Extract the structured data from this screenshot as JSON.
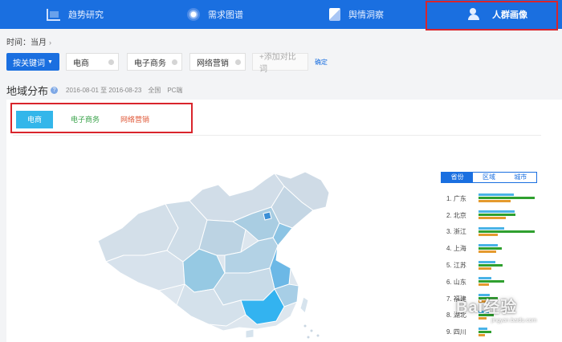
{
  "nav": {
    "items": [
      {
        "label": "趋势研究",
        "icon": "trend-chart-icon"
      },
      {
        "label": "需求图谱",
        "icon": "demand-graph-icon"
      },
      {
        "label": "舆情洞察",
        "icon": "opinion-icon"
      },
      {
        "label": "人群画像",
        "icon": "user-profile-icon"
      }
    ],
    "active_index": 3
  },
  "time": {
    "label": "时间：当月"
  },
  "keywords": {
    "type_button": "按关键词",
    "chips": [
      "电商",
      "电子商务",
      "网络营销"
    ],
    "add_label": "+添加对比词",
    "confirm_label": "确定"
  },
  "region": {
    "title": "地域分布",
    "date_range": "2016-08-01 至 2016-08-23",
    "scope": "全国",
    "platform": "PC端"
  },
  "compare_tabs": [
    {
      "label": "电商",
      "color": "#33b6ea"
    },
    {
      "label": "电子商务",
      "color": "#3aa34b"
    },
    {
      "label": "网络营销",
      "color": "#e05a3a"
    }
  ],
  "rank_tabs": [
    "省份",
    "区域",
    "城市"
  ],
  "rank_active": 0,
  "ranking": [
    {
      "label": "1.  广东",
      "values": [
        0.55,
        0.88,
        0.5
      ]
    },
    {
      "label": "2.  北京",
      "values": [
        0.56,
        0.58,
        0.42
      ]
    },
    {
      "label": "3.  浙江",
      "values": [
        0.4,
        0.88,
        0.3
      ]
    },
    {
      "label": "4.  上海",
      "values": [
        0.3,
        0.36,
        0.28
      ]
    },
    {
      "label": "5.  江苏",
      "values": [
        0.26,
        0.38,
        0.2
      ]
    },
    {
      "label": "6.  山东",
      "values": [
        0.2,
        0.4,
        0.16
      ]
    },
    {
      "label": "7.  福建",
      "values": [
        0.18,
        0.3,
        0.13
      ]
    },
    {
      "label": "8.  湖北",
      "values": [
        0.16,
        0.24,
        0.12
      ]
    },
    {
      "label": "9.  四川",
      "values": [
        0.14,
        0.2,
        0.1
      ]
    }
  ],
  "bar_colors": [
    "#49b3e6",
    "#2fa02f",
    "#e49a2e"
  ],
  "watermark": {
    "text": "Bai经验",
    "sub": "jingyan.baidu.com"
  }
}
